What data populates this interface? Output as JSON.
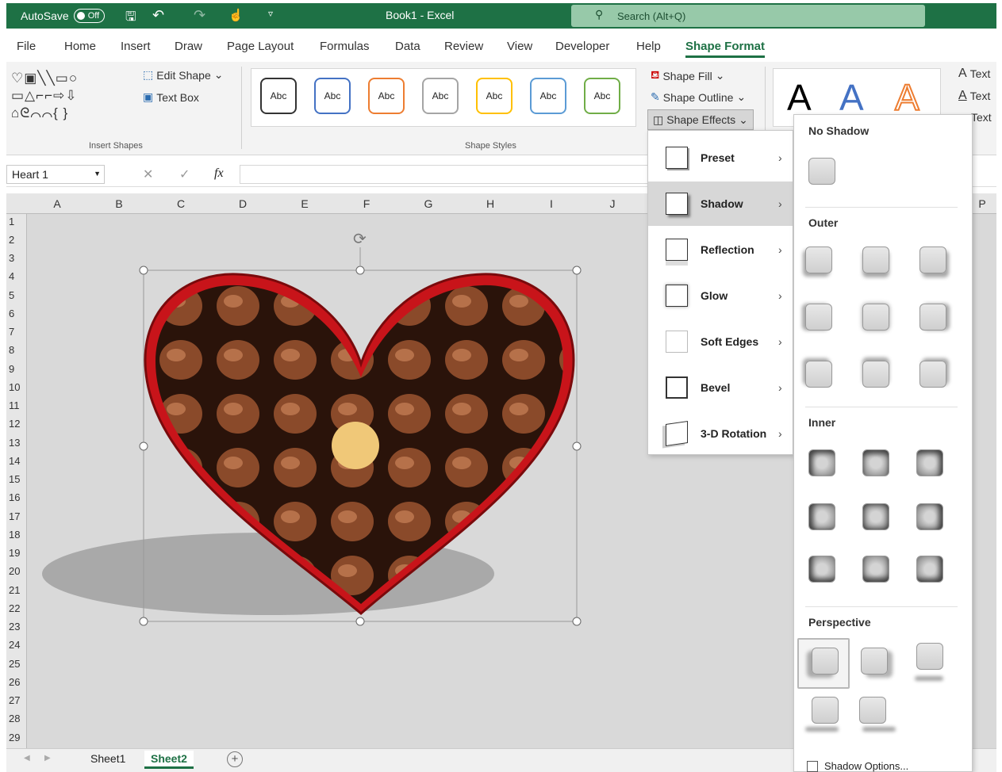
{
  "titlebar": {
    "autosave_label": "AutoSave",
    "autosave_state": "Off",
    "doc_title": "Book1  -  Excel",
    "search_placeholder": "Search (Alt+Q)"
  },
  "tabs": [
    "File",
    "Home",
    "Insert",
    "Draw",
    "Page Layout",
    "Formulas",
    "Data",
    "Review",
    "View",
    "Developer",
    "Help",
    "Shape Format"
  ],
  "active_tab": "Shape Format",
  "ribbon": {
    "insert_shapes": {
      "edit_shape": "Edit Shape",
      "text_box": "Text Box",
      "label": "Insert Shapes"
    },
    "shape_styles": {
      "sample_text": "Abc",
      "label": "Shape Styles",
      "border_colors": [
        "#333333",
        "#4472c4",
        "#ed7d31",
        "#a5a5a5",
        "#ffc000",
        "#5b9bd5",
        "#70ad47"
      ]
    },
    "shape_fill": "Shape Fill",
    "shape_outline": "Shape Outline",
    "shape_effects": "Shape Effects",
    "wordart": {
      "letters": [
        "A",
        "A",
        "A"
      ],
      "colors": [
        "#000000",
        "#4472c4",
        "#ed7d31"
      ],
      "text_fill": "Text",
      "text_outline": "Text",
      "text_effects": "Text"
    }
  },
  "formula_bar": {
    "name_box": "Heart 1",
    "fx": "fx"
  },
  "grid": {
    "columns": [
      "A",
      "B",
      "C",
      "D",
      "E",
      "F",
      "G",
      "H",
      "I",
      "J",
      "P"
    ],
    "rows": [
      "1",
      "2",
      "3",
      "4",
      "5",
      "6",
      "7",
      "8",
      "9",
      "10",
      "11",
      "12",
      "13",
      "14",
      "15",
      "16",
      "17",
      "18",
      "19",
      "20",
      "21",
      "22",
      "23",
      "24",
      "25",
      "26",
      "27",
      "28",
      "29"
    ]
  },
  "sheets": {
    "tabs": [
      "Sheet1",
      "Sheet2"
    ],
    "active": "Sheet2"
  },
  "effects_menu": {
    "items": [
      "Preset",
      "Shadow",
      "Reflection",
      "Glow",
      "Soft Edges",
      "Bevel",
      "3-D Rotation"
    ],
    "hovered": "Shadow"
  },
  "shadow_panel": {
    "no_shadow": "No Shadow",
    "outer": "Outer",
    "inner": "Inner",
    "perspective": "Perspective",
    "options": "Shadow Options..."
  }
}
